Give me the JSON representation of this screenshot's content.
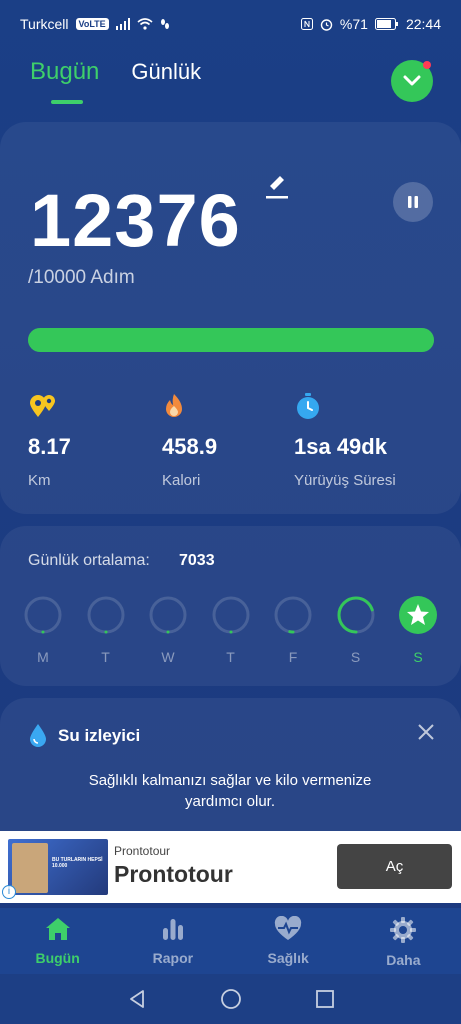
{
  "status_bar": {
    "carrier": "Turkcell",
    "volte": "VoLTE",
    "battery": "%71",
    "time": "22:44"
  },
  "tabs": [
    {
      "label": "Bugün",
      "active": true
    },
    {
      "label": "Günlük",
      "active": false
    }
  ],
  "steps": {
    "count": "12376",
    "goal": "/10000 Adım",
    "progress_fraction": 1.0
  },
  "stats": [
    {
      "icon": "location-pins-icon",
      "value": "8.17",
      "label": "Km",
      "color": "#f7c520"
    },
    {
      "icon": "flame-icon",
      "value": "458.9",
      "label": "Kalori",
      "color": "#f28a3c"
    },
    {
      "icon": "stopwatch-icon",
      "value": "1sa 49dk",
      "label": "Yürüyüş Süresi",
      "color": "#35a8f0"
    }
  ],
  "week": {
    "average_label": "Günlük ortalama:",
    "average_value": "7033",
    "days": [
      {
        "label": "M",
        "progress": 0
      },
      {
        "label": "T",
        "progress": 0
      },
      {
        "label": "W",
        "progress": 0
      },
      {
        "label": "T",
        "progress": 0
      },
      {
        "label": "F",
        "progress": 0.03
      },
      {
        "label": "S",
        "progress": 0.7
      },
      {
        "label": "S",
        "progress": 1.0,
        "today": true
      }
    ]
  },
  "water": {
    "title": "Su izleyici",
    "text": "Sağlıklı kalmanızı sağlar ve kilo vermenize yardımcı olur."
  },
  "ad": {
    "advertiser_small": "Prontotour",
    "advertiser_big": "Prontotour",
    "cta": "Aç",
    "image_text": "BU TURLARIN HEPSİ 10.000"
  },
  "bottom_nav": [
    {
      "label": "Bugün",
      "icon": "home-icon",
      "active": true
    },
    {
      "label": "Rapor",
      "icon": "bar-chart-icon",
      "active": false
    },
    {
      "label": "Sağlık",
      "icon": "heart-pulse-icon",
      "active": false
    },
    {
      "label": "Daha",
      "icon": "gear-icon",
      "active": false
    }
  ],
  "colors": {
    "accent": "#34c759",
    "background": "#1b3f86"
  }
}
